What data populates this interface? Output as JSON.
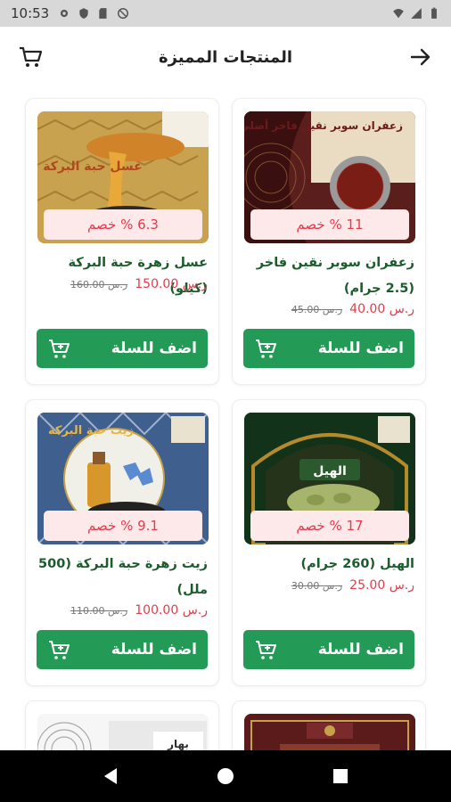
{
  "status": {
    "time": "10:53"
  },
  "header": {
    "title": "المنتجات المميزة"
  },
  "add_to_cart_label": "اضف للسلة",
  "products": [
    {
      "name": "زعفران سوبر نقين فاخر (2.5 جرام)",
      "discount": "11 % خصم",
      "price": "40.00 ر.س",
      "old_price": "45.00 ر.س",
      "image_text": "زعفران سوبر نقين فاخر أصلي"
    },
    {
      "name": "عسل زهرة حبة البركة (كيلو)",
      "discount": "6.3 % خصم",
      "price": "150.00 ر.س",
      "old_price": "160.00 ر.س",
      "image_text": "عسل حبة البركة"
    },
    {
      "name": "الهيل (260 جرام)",
      "discount": "17 % خصم",
      "price": "25.00 ر.س",
      "old_price": "30.00 ر.س",
      "image_text": "الهيل"
    },
    {
      "name": "زيت زهرة حبة البركة (500 ملل)",
      "discount": "9.1 % خصم",
      "price": "100.00 ر.س",
      "old_price": "110.00 ر.س",
      "image_text": "زيت حبة البركة"
    },
    {
      "name": "",
      "discount": "",
      "price": "",
      "old_price": "",
      "image_text": "بهار"
    },
    {
      "name": "",
      "discount": "",
      "price": "",
      "old_price": "",
      "image_text": ""
    }
  ],
  "colors": {
    "accent": "#249a57",
    "discount": "#e33b4b",
    "discount_bg": "#fde8ea",
    "name": "#1c5c2c"
  },
  "icons": {
    "back": "arrow-right-icon",
    "cart": "cart-icon",
    "add": "cart-plus-icon"
  }
}
